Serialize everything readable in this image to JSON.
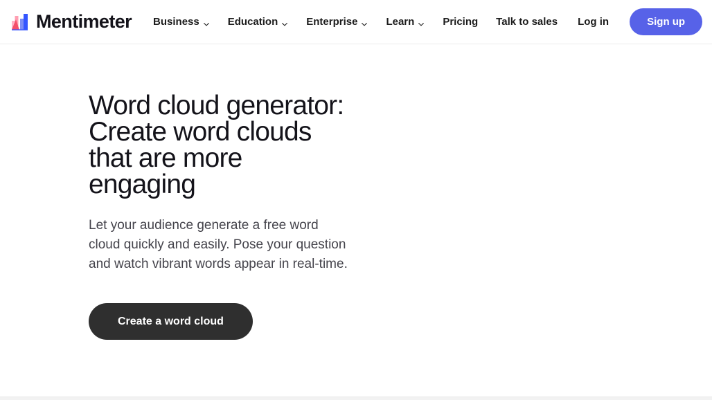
{
  "header": {
    "brand": {
      "name": "Mentimeter",
      "logo_icon": "mentimeter-bars-logo",
      "logo_colors": {
        "pink_light": "#ffb3c7",
        "pink": "#ff9fb2",
        "red": "#f4506b",
        "blue_light": "#7b8cf5",
        "blue": "#3355ff"
      }
    },
    "nav_items": [
      {
        "label": "Business",
        "has_dropdown": true,
        "icon": "chevron-down-icon"
      },
      {
        "label": "Education",
        "has_dropdown": true,
        "icon": "chevron-down-icon"
      },
      {
        "label": "Enterprise",
        "has_dropdown": true,
        "icon": "chevron-down-icon"
      },
      {
        "label": "Learn",
        "has_dropdown": true,
        "icon": "chevron-down-icon"
      },
      {
        "label": "Pricing",
        "has_dropdown": false,
        "icon": ""
      },
      {
        "label": "Talk to sales",
        "has_dropdown": false,
        "icon": ""
      }
    ],
    "login_label": "Log in",
    "signup_label": "Sign up",
    "signup_color": "#5762e8"
  },
  "hero": {
    "title": "Word cloud generator: Create word clouds that are more engaging",
    "subtitle": "Let your audience generate a free word cloud quickly and easily. Pose your question and watch vibrant words appear in real-time.",
    "cta_label": "Create a word cloud",
    "cta_color": "#2f2f2f"
  }
}
